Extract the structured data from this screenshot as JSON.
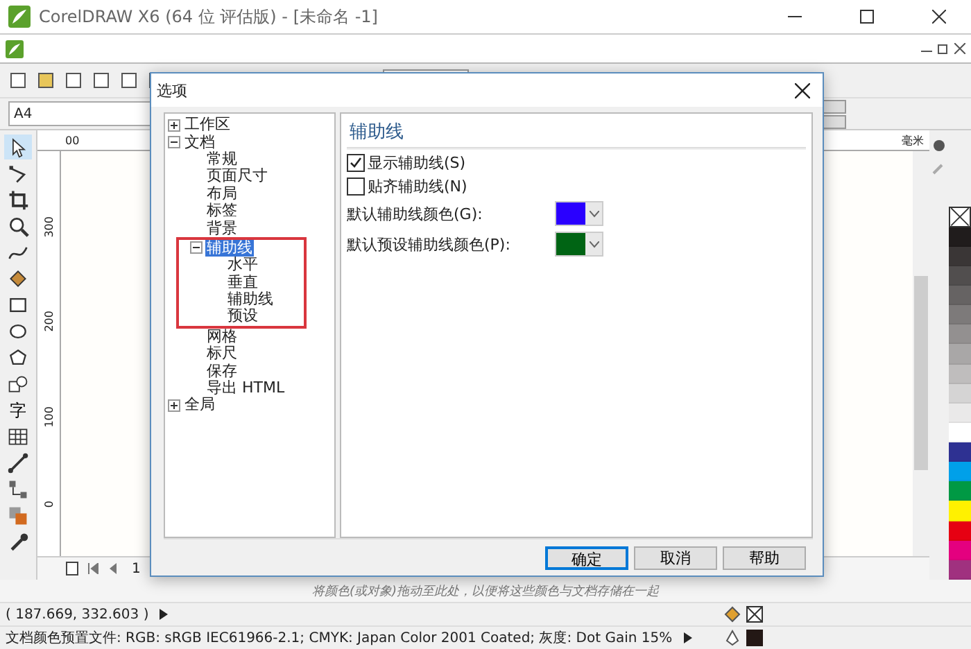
{
  "window": {
    "title": "CorelDRAW X6 (64 位 评估版) - [未命名 -1]"
  },
  "property_bar": {
    "page_size": "A4"
  },
  "toolbox": [
    {
      "kind": "pointer",
      "selected": true
    },
    {
      "kind": "shape",
      "selected": false
    },
    {
      "kind": "crop",
      "selected": false
    },
    {
      "kind": "zoom",
      "selected": false
    },
    {
      "kind": "freehand",
      "selected": false
    },
    {
      "kind": "fill",
      "selected": false
    },
    {
      "kind": "rectangle",
      "selected": false
    },
    {
      "kind": "ellipse",
      "selected": false
    },
    {
      "kind": "polygon",
      "selected": false
    },
    {
      "kind": "shapes",
      "selected": false
    },
    {
      "kind": "text",
      "glyph": "字",
      "selected": false
    },
    {
      "kind": "table",
      "selected": false
    },
    {
      "kind": "dimension",
      "selected": false
    },
    {
      "kind": "connector",
      "selected": false
    },
    {
      "kind": "blend",
      "selected": false
    },
    {
      "kind": "eyedropper",
      "selected": false
    }
  ],
  "ruler": {
    "top_label": "00",
    "unit": "毫米",
    "vertical_labels": [
      "300",
      "200",
      "100",
      "0"
    ]
  },
  "page_nav": {
    "page": "1"
  },
  "palette": [
    {
      "color": "#201c1c"
    },
    {
      "color": "#3a3636"
    },
    {
      "color": "#514e4e"
    },
    {
      "color": "#666363"
    },
    {
      "color": "#7d7a7a"
    },
    {
      "color": "#939090"
    },
    {
      "color": "#a9a7a7"
    },
    {
      "color": "#bfbdbd"
    },
    {
      "color": "#d5d4d4"
    },
    {
      "color": "#eae9e9"
    },
    {
      "color": "#ffffff"
    },
    {
      "color": "#2e3192"
    },
    {
      "color": "#00a0e9"
    },
    {
      "color": "#009944"
    },
    {
      "color": "#fff100"
    },
    {
      "color": "#e60012"
    },
    {
      "color": "#e4007f"
    },
    {
      "color": "#a0317f"
    }
  ],
  "dialog": {
    "title": "选项",
    "tree": [
      {
        "label": "工作区",
        "expanded": false,
        "selected": false
      },
      {
        "label": "文档",
        "expanded": true,
        "selected": false,
        "children": [
          {
            "label": "常规",
            "selected": false,
            "annotated": false
          },
          {
            "label": "页面尺寸",
            "selected": false,
            "annotated": false
          },
          {
            "label": "布局",
            "selected": false,
            "annotated": false
          },
          {
            "label": "标签",
            "selected": false,
            "annotated": false
          },
          {
            "label": "背景",
            "selected": false,
            "annotated": false
          },
          {
            "label": "辅助线",
            "expanded": true,
            "selected": true,
            "annotated": true,
            "children": [
              {
                "label": "水平",
                "selected": false
              },
              {
                "label": "垂直",
                "selected": false
              },
              {
                "label": "辅助线",
                "selected": false
              },
              {
                "label": "预设",
                "selected": false
              }
            ]
          },
          {
            "label": "网格",
            "selected": false,
            "annotated": false
          },
          {
            "label": "标尺",
            "selected": false,
            "annotated": false
          },
          {
            "label": "保存",
            "selected": false,
            "annotated": false
          },
          {
            "label": "导出 HTML",
            "selected": false,
            "annotated": false
          }
        ]
      },
      {
        "label": "全局",
        "expanded": false,
        "selected": false
      }
    ],
    "panel_title": "辅助线",
    "checkboxes": [
      {
        "label": "显示辅助线(S)",
        "checked": true
      },
      {
        "label": "贴齐辅助线(N)",
        "checked": false
      }
    ],
    "color_fields": [
      {
        "label": "默认辅助线颜色(G):",
        "color": "#2a00ff"
      },
      {
        "label": "默认预设辅助线颜色(P):",
        "color": "#006414"
      }
    ],
    "buttons": [
      {
        "label": "确定",
        "default": true
      },
      {
        "label": "取消",
        "default": false
      },
      {
        "label": "帮助",
        "default": false
      }
    ]
  },
  "hint": "将颜色(或对象)拖动至此处，以便将这些颜色与文档存储在一起",
  "status_bar": {
    "coordinates": "( 187.669, 332.603 )",
    "color_profile": "文档颜色预置文件: RGB: sRGB IEC61966-2.1; CMYK: Japan Color 2001 Coated; 灰度: Dot Gain 15%"
  }
}
